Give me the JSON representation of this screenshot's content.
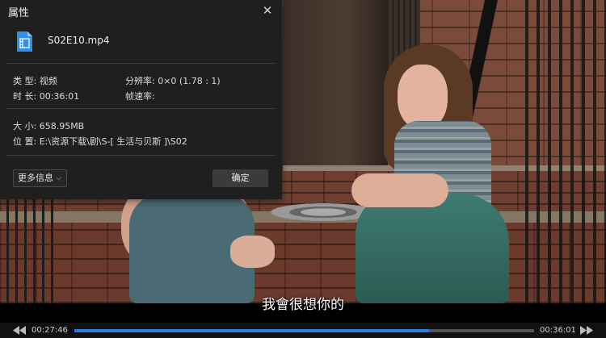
{
  "dialog": {
    "title": "属性",
    "file_name": "S02E10.mp4",
    "type_label": "类 型:",
    "type_value": "视频",
    "resolution_label": "分辨率:",
    "resolution_value": "0×0 (1.78 : 1)",
    "duration_label": "时 长:",
    "duration_value": "00:36:01",
    "framerate_label": "帧速率:",
    "framerate_value": "",
    "size_label": "大 小:",
    "size_value": "658.95MB",
    "location_label": "位 置:",
    "location_value": "E:\\资源下载\\剧\\S-[ 生活与贝斯 ]\\S02",
    "more_info_label": "更多信息",
    "ok_label": "确定"
  },
  "subtitle": "我會很想你的",
  "player": {
    "current_time": "00:27:46",
    "total_time": "00:36:01",
    "progress_fraction": 0.771,
    "accent_color": "#2a7de1"
  },
  "icons": {
    "file": "video-file-icon",
    "close": "close-icon",
    "rewind": "rewind-icon",
    "forward": "fast-forward-icon"
  }
}
